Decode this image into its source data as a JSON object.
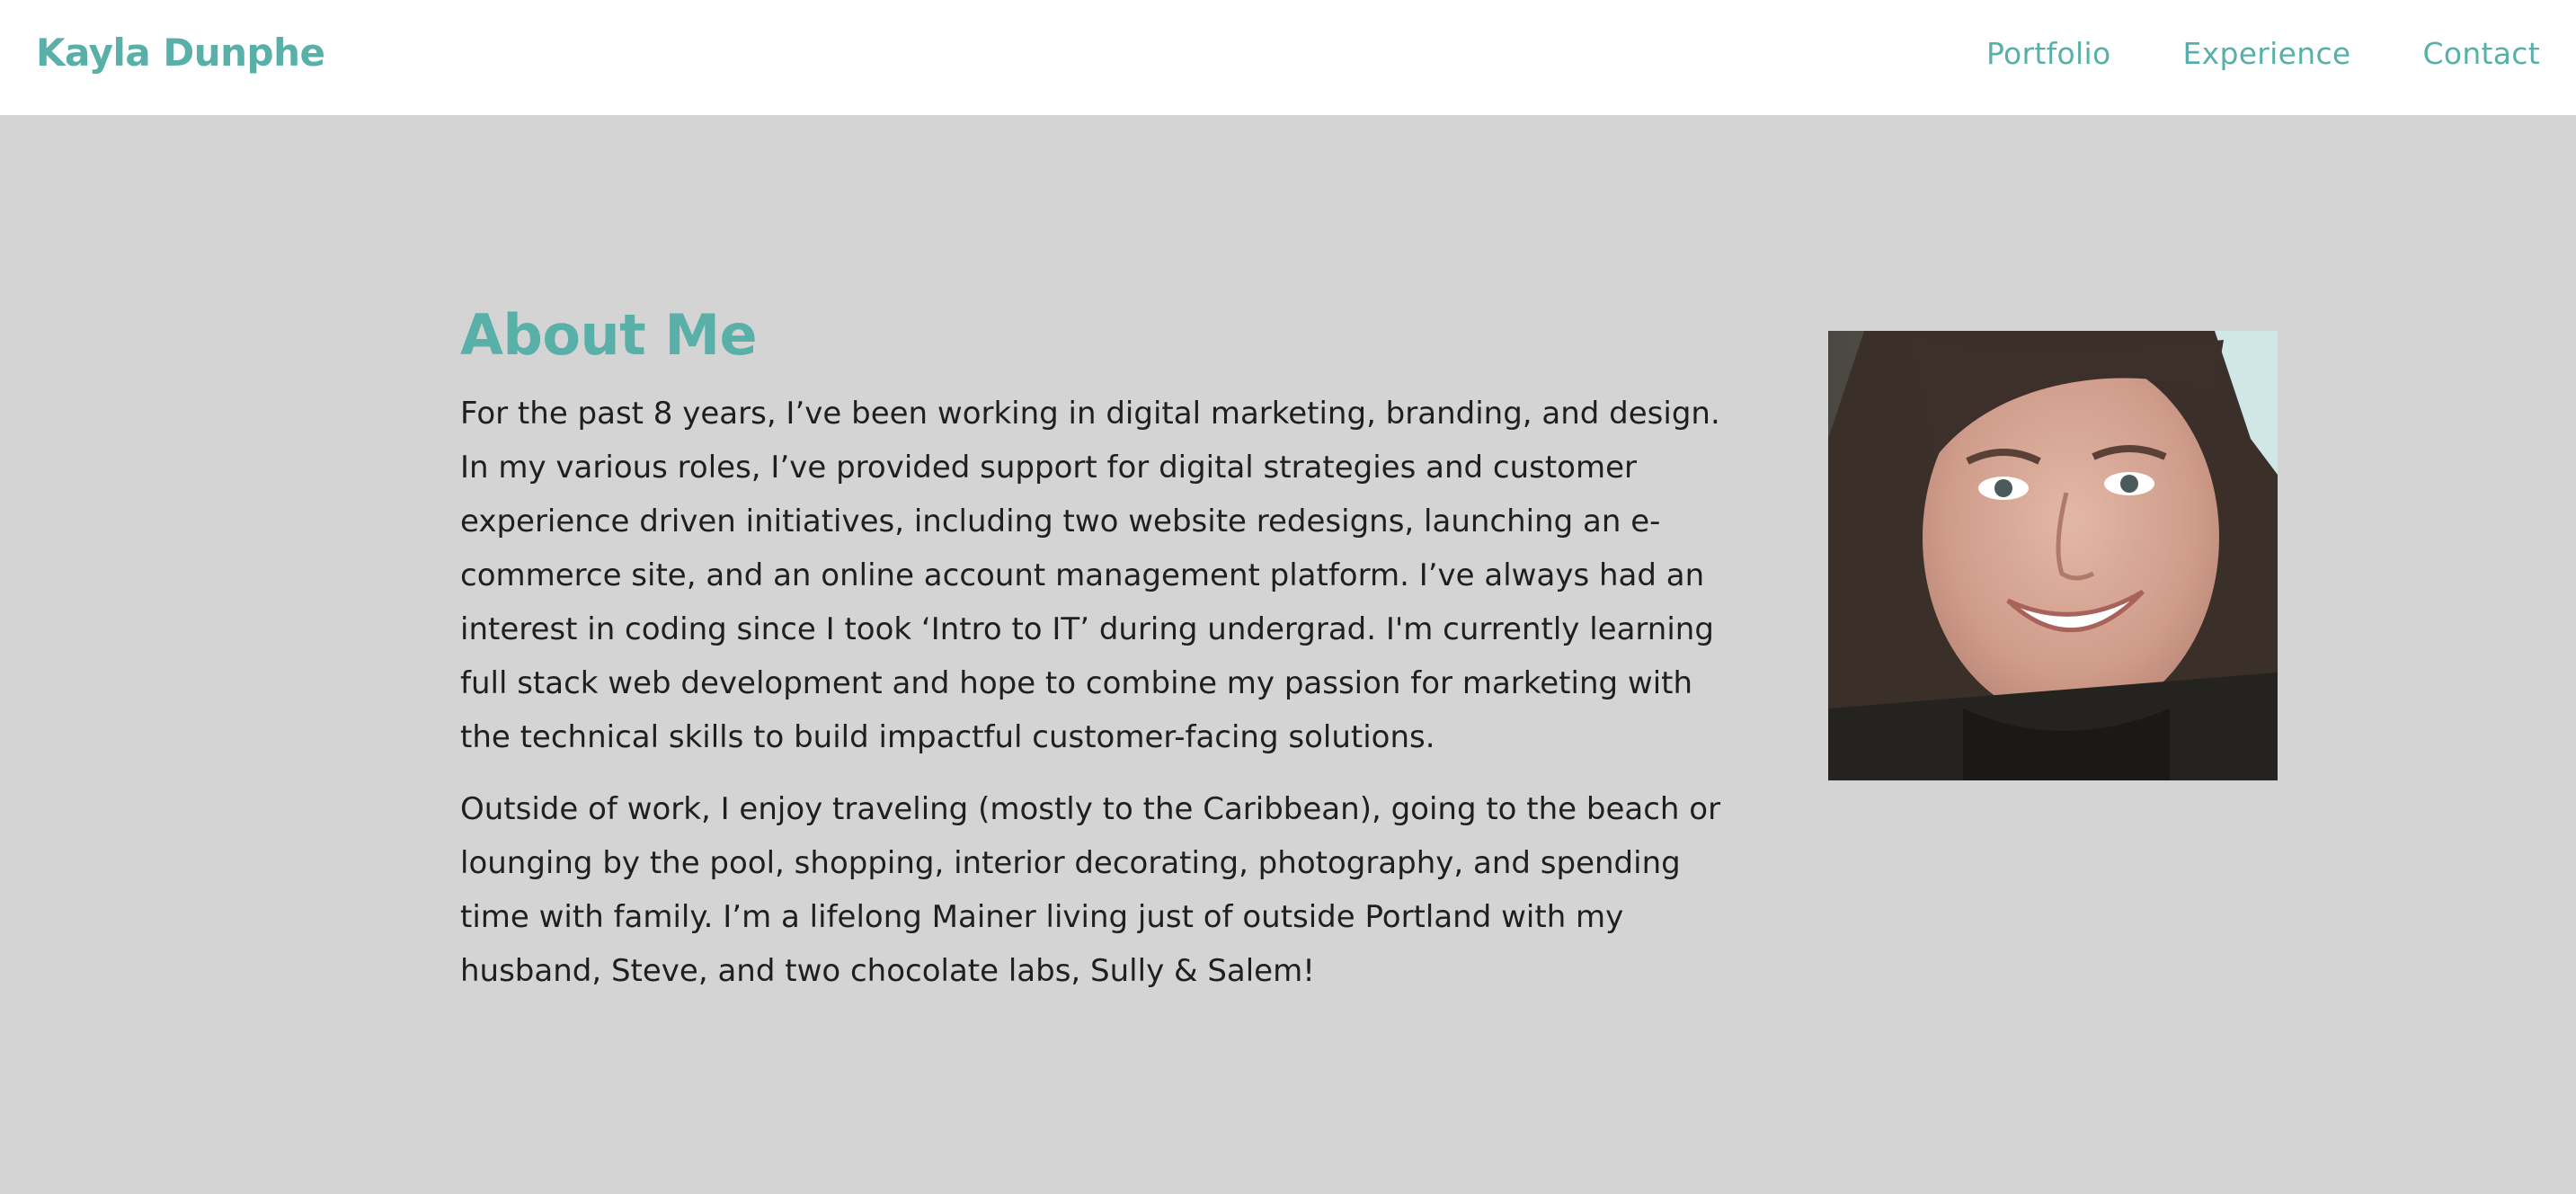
{
  "header": {
    "brand": "Kayla Dunphe",
    "nav": [
      "Portfolio",
      "Experience",
      "Contact"
    ]
  },
  "about": {
    "title": "About Me",
    "paragraphs": [
      "For the past 8 years, I’ve been working in digital marketing, branding, and design. In my various roles, I’ve provided support for digital strategies and customer experience driven initiatives, including two website redesigns, launching an e-commerce site, and an online account management platform. I’ve always had an interest in coding since I took ‘Intro to IT’ during undergrad. I'm currently learning full stack web development and hope to combine my passion for marketing with the technical skills to build impactful customer-facing solutions.",
      "Outside of work, I enjoy traveling (mostly to the Caribbean), going to the beach or lounging by the pool, shopping, interior decorating, photography, and spending time with family. I’m a lifelong Mainer living just of outside Portland with my husband, Steve, and two chocolate labs, Sully & Salem!"
    ]
  },
  "colors": {
    "accent": "#58b0a8",
    "header_bg": "#ffffff",
    "page_bg": "#d4d4d4",
    "text": "#1f1f1f"
  }
}
